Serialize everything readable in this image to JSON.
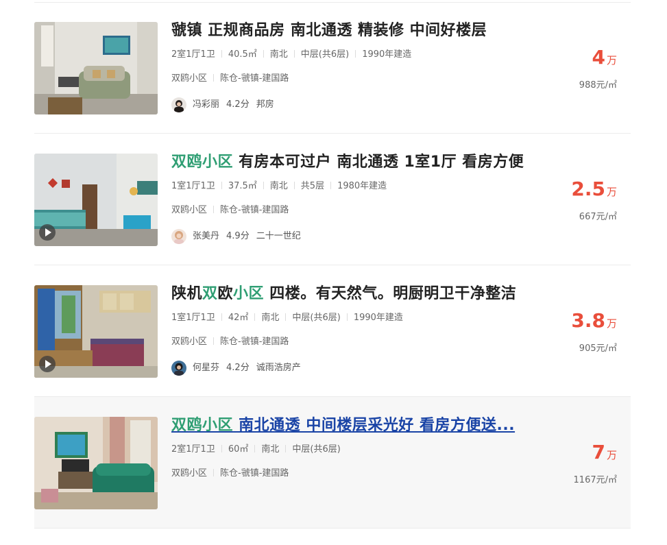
{
  "listings": [
    {
      "title_hl": "",
      "title_rest": "虢镇 正规商品房 南北通透 精装修 中间好楼层",
      "layout": "2室1厅1卫",
      "area": "40.5㎡",
      "orientation": "南北",
      "floor": "中层(共6层)",
      "year": "1990年建造",
      "community": "双鸥小区",
      "district": "陈仓-虢镇-建国路",
      "agent_name": "冯彩丽",
      "agent_score": "4.2分",
      "agent_company": "邦房",
      "price_value": "4",
      "price_unit": "万",
      "unit_price": "988元/㎡"
    },
    {
      "title_hl": "双鸥小区",
      "title_rest": " 有房本可过户 南北通透 1室1厅 看房方便",
      "layout": "1室1厅1卫",
      "area": "37.5㎡",
      "orientation": "南北",
      "floor": "共5层",
      "year": "1980年建造",
      "community": "双鸥小区",
      "district": "陈仓-虢镇-建国路",
      "agent_name": "张美丹",
      "agent_score": "4.9分",
      "agent_company": "二十一世纪",
      "price_value": "2.5",
      "price_unit": "万",
      "unit_price": "667元/㎡"
    },
    {
      "title_parts": [
        "陕机",
        "双",
        "欧",
        "小区",
        " 四楼。有天然气。明厨明卫干净整洁"
      ],
      "layout": "1室1厅1卫",
      "area": "42㎡",
      "orientation": "南北",
      "floor": "中层(共6层)",
      "year": "1990年建造",
      "community": "双鸥小区",
      "district": "陈仓-虢镇-建国路",
      "agent_name": "何星芬",
      "agent_score": "4.2分",
      "agent_company": "诚雨浩房产",
      "price_value": "3.8",
      "price_unit": "万",
      "unit_price": "905元/㎡"
    },
    {
      "title_hl": "双鸥小区",
      "title_rest": " 南北通透 中间楼层采光好 看房方便送...",
      "layout": "2室1厅1卫",
      "area": "60㎡",
      "orientation": "南北",
      "floor": "中层(共6层)",
      "community": "双鸥小区",
      "district": "陈仓-虢镇-建国路",
      "price_value": "7",
      "price_unit": "万",
      "unit_price": "1167元/㎡"
    }
  ],
  "colors": {
    "highlight": "#2f9e73",
    "price": "#e94e3b",
    "link_hover": "#1a44a6"
  }
}
